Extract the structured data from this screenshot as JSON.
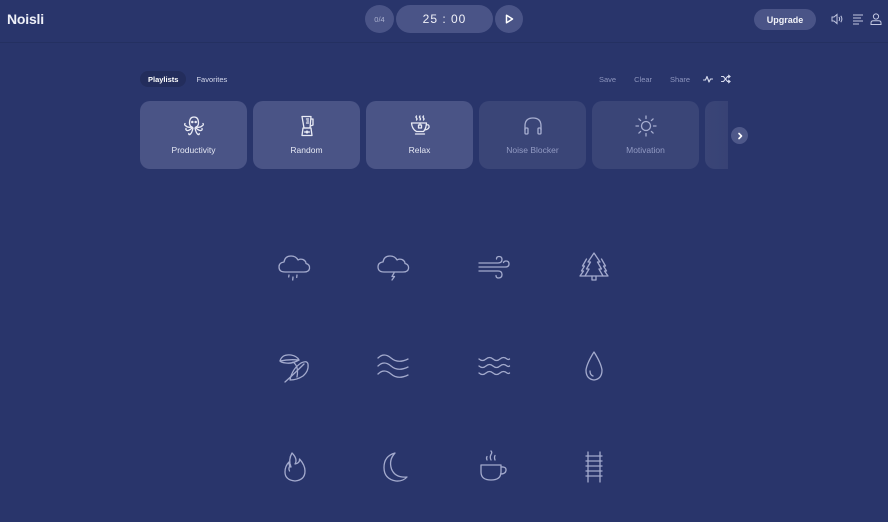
{
  "app": {
    "title": "Noisli"
  },
  "header": {
    "session_counter": "0/4",
    "timer": "25 : 00",
    "play_icon": "play-icon",
    "upgrade_label": "Upgrade",
    "icons": [
      "volume-icon",
      "menu-icon",
      "user-icon"
    ]
  },
  "tabs": [
    {
      "label": "Playlists",
      "active": true
    },
    {
      "label": "Favorites",
      "active": false
    }
  ],
  "actions": {
    "save": "Save",
    "clear": "Clear",
    "share": "Share",
    "icons": [
      "activity-icon",
      "shuffle-icon"
    ]
  },
  "playlists": [
    {
      "label": "Productivity",
      "icon": "octopus-icon"
    },
    {
      "label": "Random",
      "icon": "blender-icon"
    },
    {
      "label": "Relax",
      "icon": "tea-cup-icon"
    },
    {
      "label": "Noise Blocker",
      "icon": "headphones-icon"
    },
    {
      "label": "Motivation",
      "icon": "sun-icon"
    }
  ],
  "sounds": [
    {
      "name": "rain",
      "icon": "rain-cloud-icon"
    },
    {
      "name": "thunderstorm",
      "icon": "thunder-cloud-icon"
    },
    {
      "name": "wind",
      "icon": "wind-icon"
    },
    {
      "name": "forest",
      "icon": "forest-icon"
    },
    {
      "name": "leaves",
      "icon": "leaves-icon"
    },
    {
      "name": "water-stream",
      "icon": "stream-waves-icon"
    },
    {
      "name": "seaside",
      "icon": "sea-waves-icon"
    },
    {
      "name": "water",
      "icon": "water-drop-icon"
    },
    {
      "name": "fire",
      "icon": "fire-icon"
    },
    {
      "name": "summer-night",
      "icon": "moon-icon"
    },
    {
      "name": "coffee-shop",
      "icon": "coffee-cup-icon"
    },
    {
      "name": "train",
      "icon": "train-track-icon"
    }
  ]
}
